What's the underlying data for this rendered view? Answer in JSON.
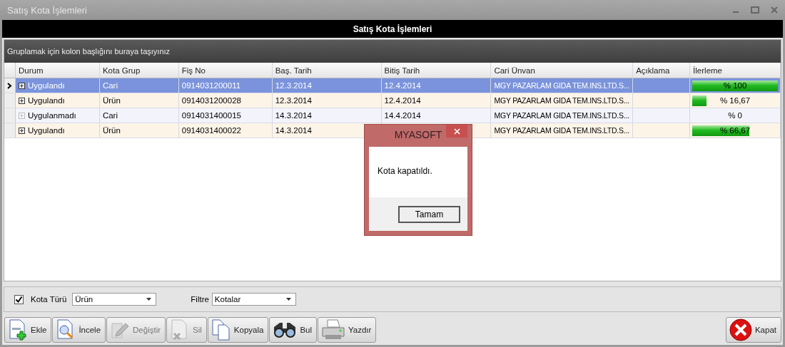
{
  "window": {
    "title": "Satış Kota İşlemleri"
  },
  "header": {
    "title": "Satış Kota İşlemleri"
  },
  "group_panel": {
    "hint": "Gruplamak için kolon başlığını buraya taşıyınız"
  },
  "table": {
    "columns": [
      "Durum",
      "Kota Grup",
      "Fiş No",
      "Baş. Tarih",
      "Bitiş Tarih",
      "Cari Ünvan",
      "Açıklama",
      "İlerleme"
    ],
    "rows": [
      {
        "selected": true,
        "expand_disabled": false,
        "durum": "Uygulandı",
        "kota_grup": "Cari",
        "fis_no": "0914031200011",
        "bas_tarih": "12.3.2014",
        "bitis_tarih": "12.4.2014",
        "cari_unvan": "MGY PAZARLAM GIDA TEM.INS.LTD.S...",
        "level": 1,
        "reading": "% 100"
      },
      {
        "selected": false,
        "expand_disabled": false,
        "durum": "Uygulandı",
        "kota_grup": "Ürün",
        "fis_no": "0914031200028",
        "bas_tarih": "12.3.2014",
        "bitis_tarih": "12.4.2014",
        "cari_unvan": "MGY PAZARLAM GIDA TEM.INS.LTD.S...",
        "level": 0.1667,
        "reading": "% 16,67"
      },
      {
        "selected": false,
        "expand_disabled": true,
        "durum": "Uygulanmadı",
        "kota_grup": "Cari",
        "fis_no": "0914031400015",
        "bas_tarih": "14.3.2014",
        "bitis_tarih": "14.4.2014",
        "cari_unvan": "MGY PAZARLAM GIDA TEM.INS.LTD.S...",
        "level": 0,
        "reading": "% 0"
      },
      {
        "selected": false,
        "expand_disabled": false,
        "durum": "Uygulandı",
        "kota_grup": "Ürün",
        "fis_no": "0914031400022",
        "bas_tarih": "14.3.2014",
        "cari_unvan": "MGY PAZARLAM GIDA TEM.INS.LTD.S...",
        "level": 0.6667,
        "reading": "% 66,67"
      }
    ]
  },
  "filters": {
    "kota_turu": {
      "checked": true,
      "label": "Kota Türü",
      "value": "Ürün"
    },
    "filtre": {
      "label": "Filtre",
      "value": "Kotalar"
    }
  },
  "buttons": [
    {
      "kind": "add",
      "label": "Ekle",
      "disabled": false
    },
    {
      "kind": "inspect",
      "label": "İncele",
      "disabled": false
    },
    {
      "kind": "edit",
      "label": "Değiştir",
      "disabled": true
    },
    {
      "kind": "delete",
      "label": "Sil",
      "disabled": true
    },
    {
      "kind": "copy",
      "label": "Kopyala",
      "disabled": false
    },
    {
      "kind": "find",
      "label": "Bul",
      "disabled": false
    },
    {
      "kind": "print",
      "label": "Yazdır",
      "disabled": false
    },
    {
      "kind": "close",
      "label": "Kapat",
      "disabled": false
    }
  ],
  "dialog": {
    "title": "MYASOFT",
    "message": "Kota kapatıldı.",
    "button": "Tamam"
  }
}
